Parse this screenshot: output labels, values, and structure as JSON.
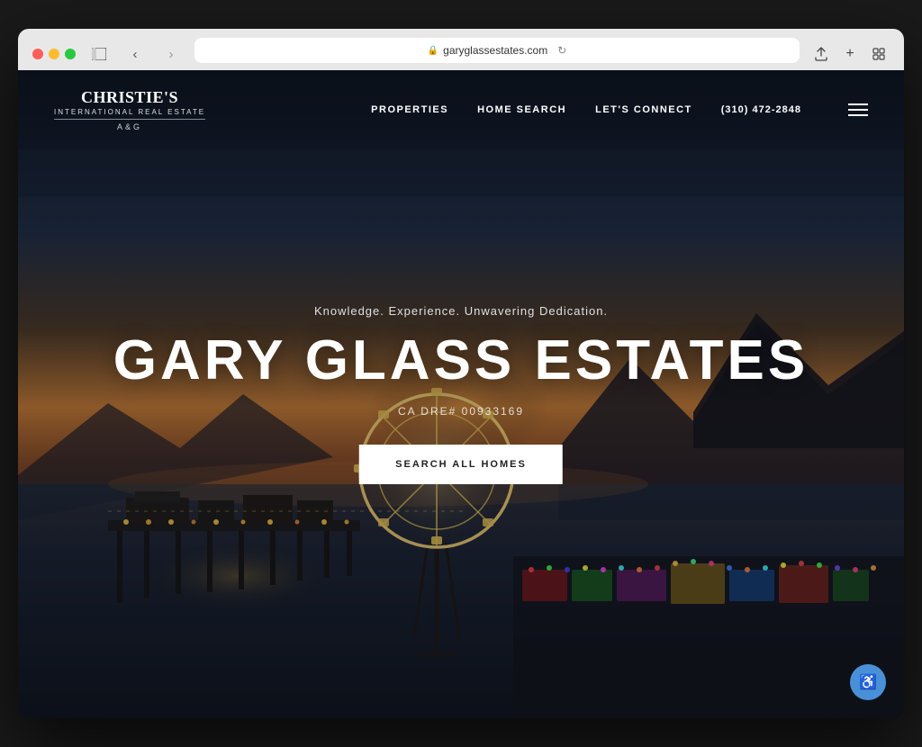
{
  "browser": {
    "url": "garyglassestates.com",
    "reload_title": "Reload page"
  },
  "nav": {
    "logo_main": "CHRISTIE'S",
    "logo_sub": "INTERNATIONAL REAL ESTATE",
    "logo_akg": "A&G",
    "link_properties": "PROPERTIES",
    "link_home_search": "HOME SEARCH",
    "link_connect": "LET'S CONNECT",
    "phone": "(310) 472-2848"
  },
  "hero": {
    "tagline": "Knowledge. Experience. Unwavering Dedication.",
    "title": "GARY GLASS ESTATES",
    "dre": "CA DRE# 00933169",
    "cta_label": "SEARCH ALL HOMES"
  },
  "accessibility": {
    "icon": "♿",
    "label": "Accessibility"
  }
}
